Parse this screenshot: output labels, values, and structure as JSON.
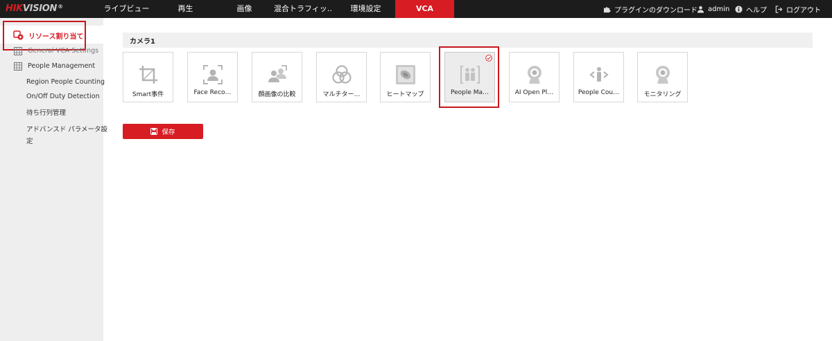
{
  "brand": {
    "name_red": "HIK",
    "name_gray": "VISION",
    "registered": "®"
  },
  "nav": [
    {
      "label": "ライブビュー"
    },
    {
      "label": "再生"
    },
    {
      "label": "画像"
    },
    {
      "label": "混合トラフィッ…"
    },
    {
      "label": "環境設定"
    },
    {
      "label": "VCA",
      "active": true
    }
  ],
  "top_right": {
    "plugin_download": "プラグインのダウンロード",
    "user": "admin",
    "help": "ヘルプ",
    "logout": "ログアウト"
  },
  "sidebar": {
    "active_item": "リソース割り当て",
    "items": [
      {
        "label": "General VCA Settings"
      },
      {
        "label": "People Management"
      }
    ],
    "sub_items": [
      {
        "label": "Region People Counting"
      },
      {
        "label": "On/Off Duty Detection"
      },
      {
        "label": "待ち行列管理"
      },
      {
        "label": "アドバンスド パラメータ設",
        "label_line2": "定"
      }
    ]
  },
  "main": {
    "section_title": "カメラ1",
    "tiles": [
      {
        "label": "Smart事件",
        "icon": "crop-frame-icon"
      },
      {
        "label": "Face Reco…",
        "icon": "face-frame-icon"
      },
      {
        "label": "顔画像の比較",
        "icon": "face-compare-icon"
      },
      {
        "label": "マルチター…",
        "icon": "multi-target-icon"
      },
      {
        "label": "ヒートマップ",
        "icon": "heatmap-icon"
      },
      {
        "label": "People Ma…",
        "icon": "people-management-icon",
        "selected": true
      },
      {
        "label": "AI Open Pl…",
        "icon": "camera-icon"
      },
      {
        "label": "People Cou…",
        "icon": "people-counting-icon"
      },
      {
        "label": "モニタリング",
        "icon": "camera-icon"
      }
    ],
    "save_label": "保存"
  },
  "colors": {
    "accent": "#d71c24",
    "topbar": "#1c1c1c",
    "sidebar": "#eeeeee",
    "icon_gray": "#b4b4b4"
  }
}
